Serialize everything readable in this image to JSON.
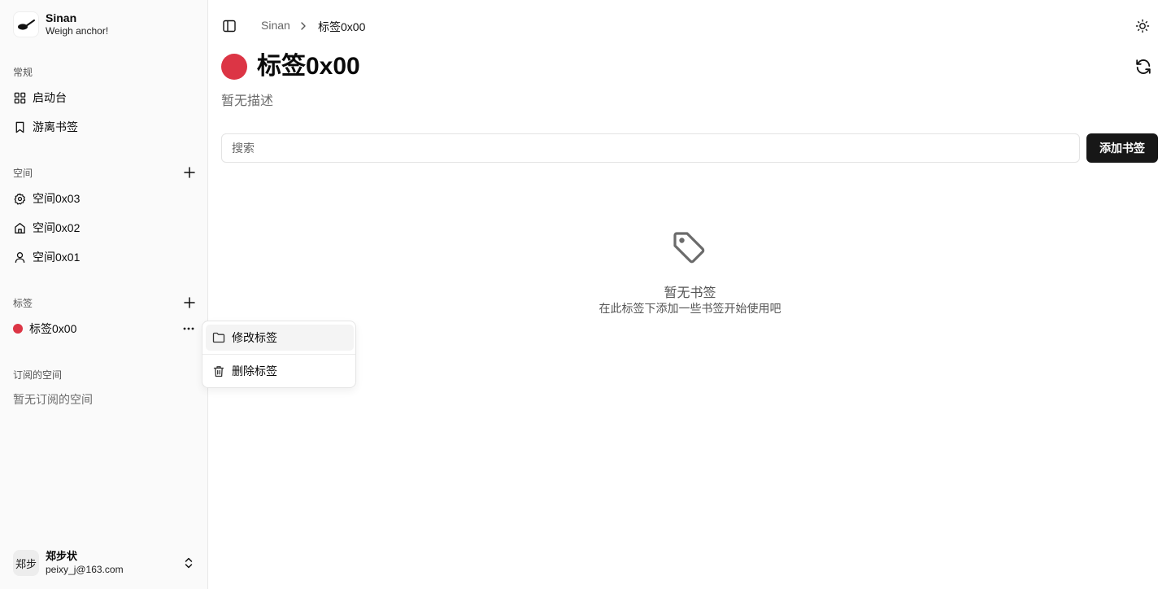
{
  "brand": {
    "name": "Sinan",
    "tagline": "Weigh anchor!",
    "logo_icon": "ladle-icon"
  },
  "sidebar": {
    "general": {
      "label": "常规",
      "items": [
        {
          "label": "启动台",
          "icon": "grid-icon"
        },
        {
          "label": "游离书签",
          "icon": "bookmark-icon"
        }
      ]
    },
    "spaces": {
      "label": "空间",
      "items": [
        {
          "label": "空间0x03",
          "icon": "gear-icon"
        },
        {
          "label": "空间0x02",
          "icon": "home-icon"
        },
        {
          "label": "空间0x01",
          "icon": "user-icon"
        }
      ]
    },
    "tags": {
      "label": "标签",
      "items": [
        {
          "label": "标签0x00",
          "color": "#dc3545"
        }
      ]
    },
    "subscribed": {
      "label": "订阅的空间",
      "empty": "暂无订阅的空间"
    }
  },
  "user": {
    "avatar_text": "郑步",
    "name": "郑步状",
    "email": "peixy_j@163.com"
  },
  "breadcrumb": {
    "root": "Sinan",
    "current": "标签0x00"
  },
  "page": {
    "title": "标签0x00",
    "dot_color": "#dc3545",
    "description": "暂无描述",
    "search_placeholder": "搜索",
    "add_button": "添加书签",
    "empty_title": "暂无书签",
    "empty_desc": "在此标签下添加一些书签开始使用吧"
  },
  "context_menu": {
    "items": [
      {
        "label": "修改标签",
        "icon": "folder-icon"
      },
      {
        "label": "删除标签",
        "icon": "trash-icon"
      }
    ]
  }
}
